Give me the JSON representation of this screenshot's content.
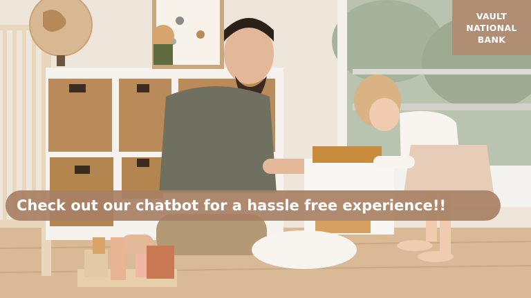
{
  "brand": {
    "line1": "VAULT",
    "line2": "NATIONAL",
    "line3": "BANK",
    "color": "#b08e74"
  },
  "banner": {
    "text": "Check out our chatbot for a hassle free experience!!",
    "color": "#a88064"
  },
  "photo": {
    "subject": "father-and-toddler-playing-icon"
  }
}
